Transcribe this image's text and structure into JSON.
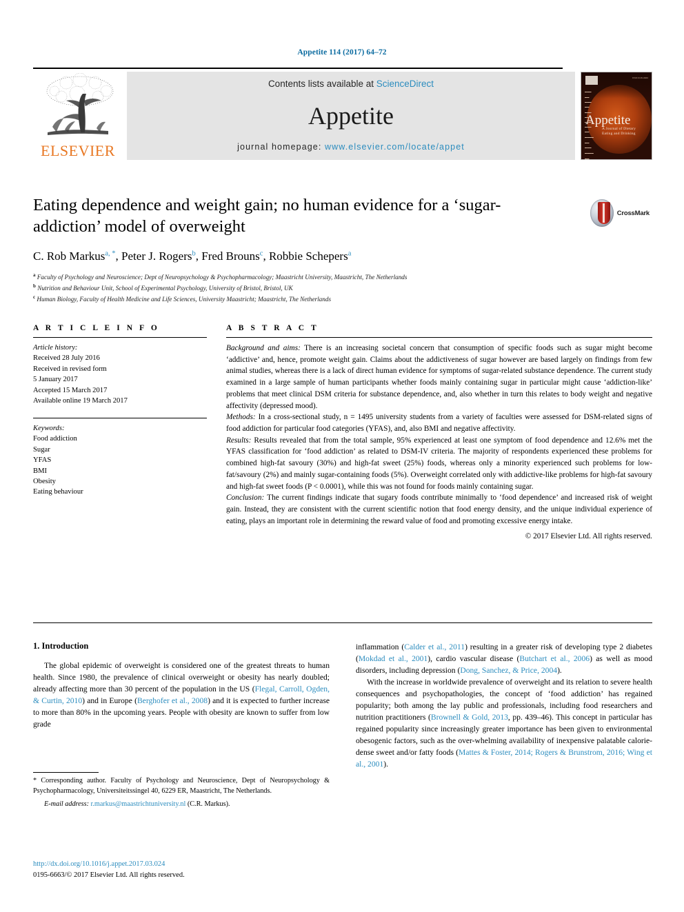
{
  "running_head": "Appetite 114 (2017) 64–72",
  "masthead": {
    "publisher_name": "ELSEVIER",
    "contents_prefix": "Contents lists available at ",
    "contents_link": "ScienceDirect",
    "journal_name": "Appetite",
    "homepage_label": "journal homepage: ",
    "homepage_url": "www.elsevier.com/locate/appet",
    "cover": {
      "title": "Appetite",
      "subtitle_line1": "A Journal of Dietary",
      "subtitle_line2": "Eating and Drinking"
    }
  },
  "article": {
    "title": "Eating dependence and weight gain; no human evidence for a ‘sugar-addiction’ model of overweight",
    "crossmark_label": "CrossMark",
    "authors": [
      {
        "name": "C. Rob Markus",
        "marks": "a, *"
      },
      {
        "name": "Peter J. Rogers",
        "marks": "b"
      },
      {
        "name": "Fred Brouns",
        "marks": "c"
      },
      {
        "name": "Robbie Schepers",
        "marks": "a"
      }
    ],
    "affiliations": [
      {
        "mark": "a",
        "text": "Faculty of Psychology and Neuroscience; Dept of Neuropsychology & Psychopharmacology; Maastricht University, Maastricht, The Netherlands"
      },
      {
        "mark": "b",
        "text": "Nutrition and Behaviour Unit, School of Experimental Psychology, University of Bristol, Bristol, UK"
      },
      {
        "mark": "c",
        "text": "Human Biology, Faculty of Health Medicine and Life Sciences, University Maastricht; Maastricht, The Netherlands"
      }
    ]
  },
  "article_info": {
    "heading": "A R T I C L E  I N F O",
    "history_label": "Article history:",
    "history": [
      "Received 28 July 2016",
      "Received in revised form",
      "5 January 2017",
      "Accepted 15 March 2017",
      "Available online 19 March 2017"
    ],
    "keywords_label": "Keywords:",
    "keywords": [
      "Food addiction",
      "Sugar",
      "YFAS",
      "BMI",
      "Obesity",
      "Eating behaviour"
    ]
  },
  "abstract": {
    "heading": "A B S T R A C T",
    "background_label": "Background and aims:",
    "background_text": " There is an increasing societal concern that consumption of specific foods such as sugar might become ‘addictive’ and, hence, promote weight gain. Claims about the addictiveness of sugar however are based largely on findings from few animal studies, whereas there is a lack of direct human evidence for symptoms of sugar-related substance dependence. The current study examined in a large sample of human participants whether foods mainly containing sugar in particular might cause ‘addiction-like’ problems that meet clinical DSM criteria for substance dependence, and, also whether in turn this relates to body weight and negative affectivity (depressed mood).",
    "methods_label": "Methods:",
    "methods_text": " In a cross-sectional study, n = 1495 university students from a variety of faculties were assessed for DSM-related signs of food addiction for particular food categories (YFAS), and, also BMI and negative affectivity.",
    "results_label": "Results:",
    "results_text": " Results revealed that from the total sample, 95% experienced at least one symptom of food dependence and 12.6% met the YFAS classification for ‘food addiction’ as related to DSM-IV criteria. The majority of respondents experienced these problems for combined high-fat savoury (30%) and high-fat sweet (25%) foods, whereas only a minority experienced such problems for low-fat/savoury (2%) and mainly sugar-containing foods (5%). Overweight correlated only with addictive-like problems for high-fat savoury and high-fat sweet foods (P < 0.0001), while this was not found for foods mainly containing sugar.",
    "conclusion_label": "Conclusion:",
    "conclusion_text": " The current findings indicate that sugary foods contribute minimally to ‘food dependence’ and increased risk of weight gain. Instead, they are consistent with the current scientific notion that food energy density, and the unique individual experience of eating, plays an important role in determining the reward value of food and promoting excessive energy intake.",
    "copyright": "© 2017 Elsevier Ltd. All rights reserved."
  },
  "body": {
    "section_heading": "1. Introduction",
    "left_para_1_parts": [
      {
        "t": "The global epidemic of overweight is considered one of the greatest threats to human health. Since 1980, the prevalence of clinical overweight or obesity has nearly doubled; already affecting more than 30 percent of the population in the US (",
        "cite": false
      },
      {
        "t": "Flegal, Carroll, Ogden, & Curtin, 2010",
        "cite": true
      },
      {
        "t": ") and in Europe (",
        "cite": false
      },
      {
        "t": "Berghofer et al., 2008",
        "cite": true
      },
      {
        "t": ") and it is expected to further increase to more than 80% in the upcoming years. People with obesity are known to suffer from low grade",
        "cite": false
      }
    ],
    "right_para_1_parts": [
      {
        "t": "inflammation (",
        "cite": false
      },
      {
        "t": "Calder et al., 2011",
        "cite": true
      },
      {
        "t": ") resulting in a greater risk of developing type 2 diabetes (",
        "cite": false
      },
      {
        "t": "Mokdad et al., 2001",
        "cite": true
      },
      {
        "t": "), cardio vascular disease (",
        "cite": false
      },
      {
        "t": "Butchart et al., 2006",
        "cite": true
      },
      {
        "t": ") as well as mood disorders, including depression (",
        "cite": false
      },
      {
        "t": "Dong, Sanchez, & Price, 2004",
        "cite": true
      },
      {
        "t": ").",
        "cite": false
      }
    ],
    "right_para_2_parts": [
      {
        "t": "With the increase in worldwide prevalence of overweight and its relation to severe health consequences and psychopathologies, the concept of ‘food addiction’ has regained popularity; both among the lay public and professionals, including food researchers and nutrition practitioners (",
        "cite": false
      },
      {
        "t": "Brownell & Gold, 2013",
        "cite": true
      },
      {
        "t": ", pp. 439–46). This concept in particular has regained popularity since increasingly greater importance has been given to environmental obesogenic factors, such as the over-whelming availability of inexpensive palatable calorie-dense sweet and/or fatty foods (",
        "cite": false
      },
      {
        "t": "Mattes & Foster, 2014; Rogers & Brunstrom, 2016; Wing et al., 2001",
        "cite": true
      },
      {
        "t": ").",
        "cite": false
      }
    ]
  },
  "footnotes": {
    "corresponding": "* Corresponding author. Faculty of Psychology and Neuroscience, Dept of Neuropsychology & Psychopharmacology, Universiteitssingel 40, 6229 ER, Maastricht, The Netherlands.",
    "email_label": "E-mail address:",
    "email": "r.markus@maastrichtuniversity.nl",
    "email_suffix": " (C.R. Markus)."
  },
  "footer": {
    "doi": "http://dx.doi.org/10.1016/j.appet.2017.03.024",
    "issn_line": "0195-6663/© 2017 Elsevier Ltd. All rights reserved."
  },
  "colors": {
    "link_blue": "#2b8cbe",
    "header_blue": "#0b6ba0",
    "elsevier_orange": "#e87722",
    "banner_gray": "#e4e4e4"
  }
}
